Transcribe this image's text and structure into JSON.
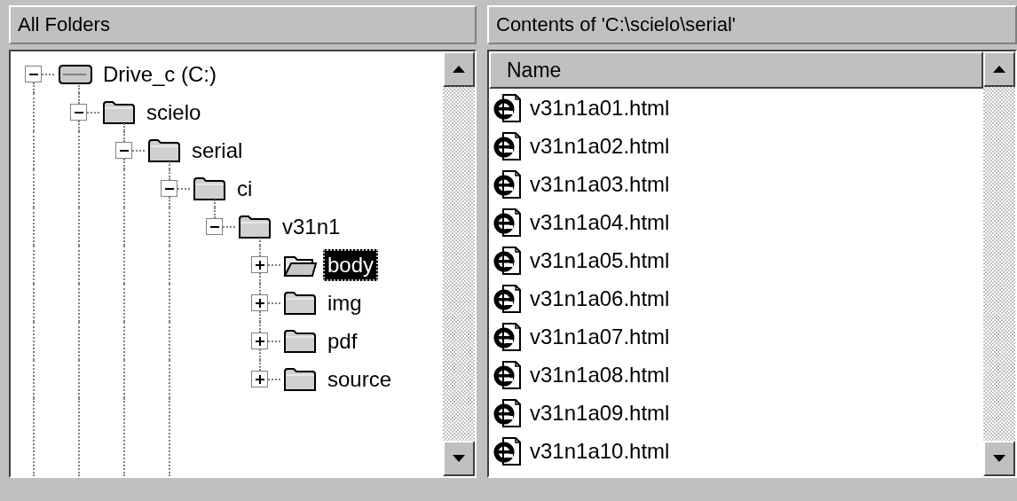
{
  "left_pane": {
    "title": "All Folders",
    "tree": [
      {
        "label": "Drive_c (C:)",
        "kind": "drive",
        "expanded": true,
        "selected": false,
        "children": [
          {
            "label": "scielo",
            "kind": "folder",
            "expanded": true,
            "selected": false,
            "children": [
              {
                "label": "serial",
                "kind": "folder",
                "expanded": true,
                "selected": false,
                "children": [
                  {
                    "label": "ci",
                    "kind": "folder",
                    "expanded": true,
                    "selected": false,
                    "children": [
                      {
                        "label": "v31n1",
                        "kind": "folder",
                        "expanded": true,
                        "selected": false,
                        "children": [
                          {
                            "label": "body",
                            "kind": "folder",
                            "expanded": false,
                            "selected": true
                          },
                          {
                            "label": "img",
                            "kind": "folder",
                            "expanded": false,
                            "selected": false
                          },
                          {
                            "label": "pdf",
                            "kind": "folder",
                            "expanded": false,
                            "selected": false
                          },
                          {
                            "label": "source",
                            "kind": "folder",
                            "expanded": false,
                            "selected": false
                          }
                        ]
                      }
                    ]
                  }
                ]
              }
            ]
          }
        ]
      }
    ]
  },
  "right_pane": {
    "title": "Contents of 'C:\\scielo\\serial'",
    "columns": [
      "Name"
    ],
    "files": [
      "v31n1a01.html",
      "v31n1a02.html",
      "v31n1a03.html",
      "v31n1a04.html",
      "v31n1a05.html",
      "v31n1a06.html",
      "v31n1a07.html",
      "v31n1a08.html",
      "v31n1a09.html",
      "v31n1a10.html"
    ]
  }
}
